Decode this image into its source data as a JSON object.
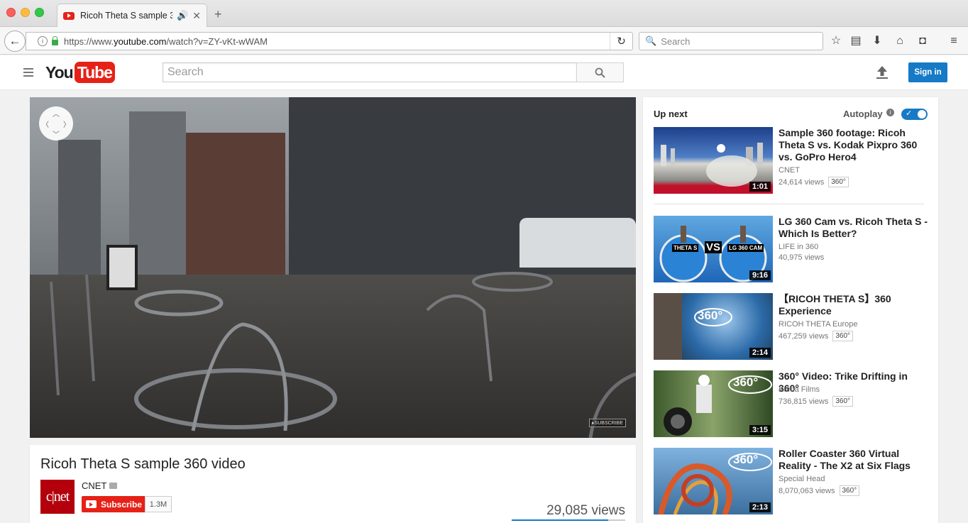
{
  "browser": {
    "tab_title": "Ricoh Theta S sample 3...",
    "url_prefix": "https://www.",
    "url_host": "youtube.com",
    "url_path": "/watch?v=ZY-vKt-wWAM",
    "search_placeholder": "Search"
  },
  "header": {
    "logo_you": "You",
    "logo_tube": "Tube",
    "search_placeholder": "Search",
    "signin_label": "Sign in"
  },
  "video": {
    "subscribe_watermark": "▸SUBSCRIBE",
    "title": "Ricoh Theta S sample 360 video",
    "channel": "CNET",
    "avatar_text": "c|net",
    "subscribe_label": "Subscribe",
    "subscriber_count": "1.3M",
    "views": "29,085 views",
    "like_ratio": 0.85
  },
  "sidebar": {
    "up_next": "Up next",
    "autoplay": "Autoplay",
    "autoplay_on": true,
    "items": [
      {
        "title": "Sample 360 footage: Ricoh Theta S vs. Kodak Pixpro 360 vs. GoPro Hero4",
        "channel": "CNET",
        "views": "24,614 views",
        "badge": "360°",
        "duration": "1:01"
      },
      {
        "title": "LG 360 Cam vs. Ricoh Theta S - Which Is Better?",
        "channel": "LIFE in 360",
        "views": "40,975 views",
        "badge": "",
        "duration": "9:16",
        "thumb_labels": [
          "THETA S",
          "VS",
          "LG 360 CAM"
        ]
      },
      {
        "title": "【RICOH THETA S】360 Experience",
        "channel": "RICOH THETA Europe",
        "views": "467,259 views",
        "badge": "360°",
        "duration": "2:14",
        "thumb_label": "360°"
      },
      {
        "title": "360° Video: Trike Drifting in 360°",
        "channel": "Kuma Films",
        "views": "736,815 views",
        "badge": "360°",
        "duration": "3:15",
        "thumb_label": "360°"
      },
      {
        "title": "Roller Coaster 360 Virtual Reality - The X2 at Six Flags",
        "channel": "Special Head",
        "views": "8,070,063 views",
        "badge": "360°",
        "duration": "2:13",
        "thumb_label": "360°"
      }
    ]
  },
  "colors": {
    "brand_red": "#e62117",
    "accent_blue": "#167ac6"
  }
}
